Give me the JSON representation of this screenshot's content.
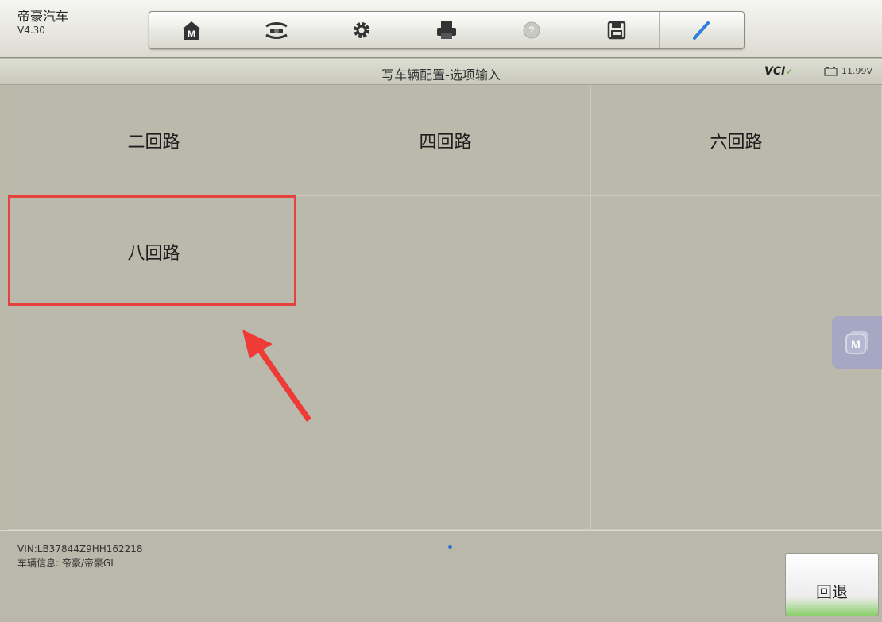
{
  "header": {
    "brand_name": "帝豪汽车",
    "version": "V4.30",
    "toolbar": [
      {
        "name": "home-icon"
      },
      {
        "name": "vehicle-swap-icon"
      },
      {
        "name": "settings-gear-icon"
      },
      {
        "name": "printer-icon"
      },
      {
        "name": "help-icon"
      },
      {
        "name": "save-icon"
      },
      {
        "name": "pen-icon"
      }
    ]
  },
  "titlebar": {
    "title": "写车辆配置-选项输入",
    "vci_label": "VCI",
    "battery_voltage": "11.99V"
  },
  "options": {
    "items": [
      "二回路",
      "四回路",
      "六回路",
      "八回路",
      "",
      "",
      "",
      "",
      "",
      "",
      "",
      ""
    ],
    "highlighted": "八回路"
  },
  "footer": {
    "vin": "VIN:LB37844Z9HH162218",
    "vehicle_info": "车辆信息: 帝豪/帝豪GL",
    "back_label": "回退"
  },
  "colors": {
    "background": "#b9b8a9",
    "highlight": "#e5413d",
    "back_button_accent": "#8ccf6a",
    "float_button": "#a6a8c3"
  }
}
